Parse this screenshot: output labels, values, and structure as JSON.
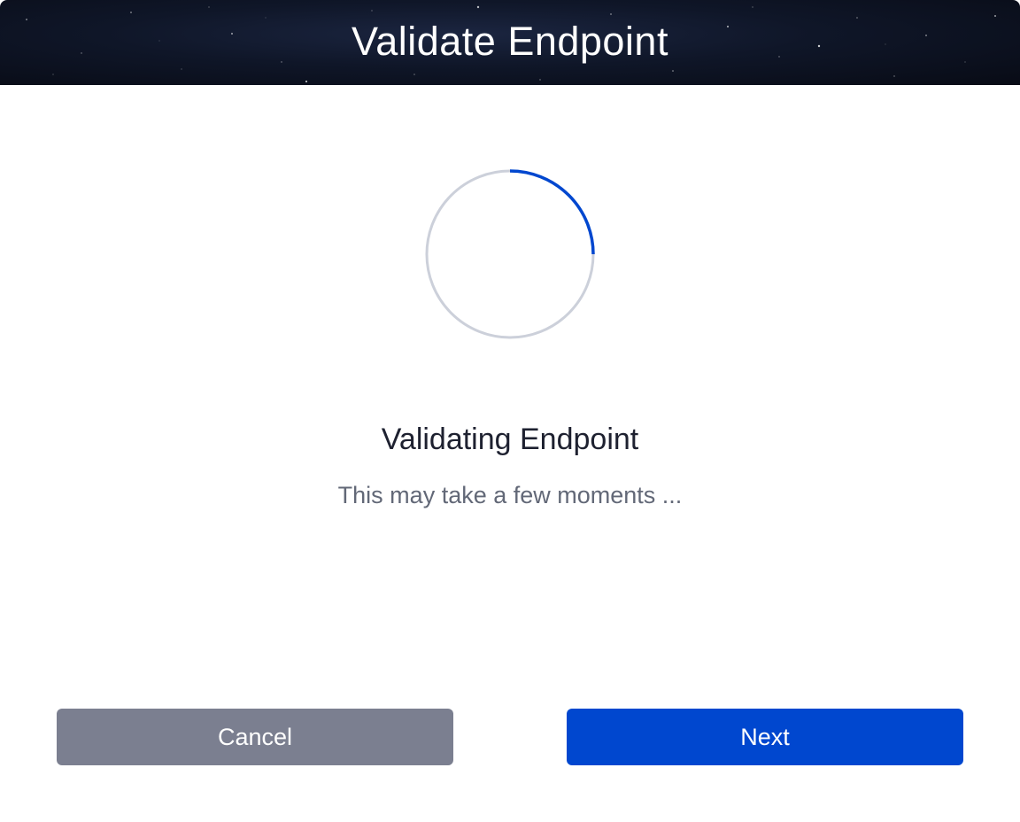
{
  "header": {
    "title": "Validate Endpoint"
  },
  "spinner": {
    "icon": "loading-spinner-icon",
    "track_color": "#ccd0da",
    "arc_color": "#0047cf",
    "progress": 0.25
  },
  "status": {
    "title": "Validating Endpoint",
    "subtitle": "This may take a few moments ..."
  },
  "buttons": {
    "cancel_label": "Cancel",
    "next_label": "Next"
  },
  "colors": {
    "primary": "#0047cf",
    "secondary": "#7b7f90",
    "header_bg": "#0f1628"
  }
}
